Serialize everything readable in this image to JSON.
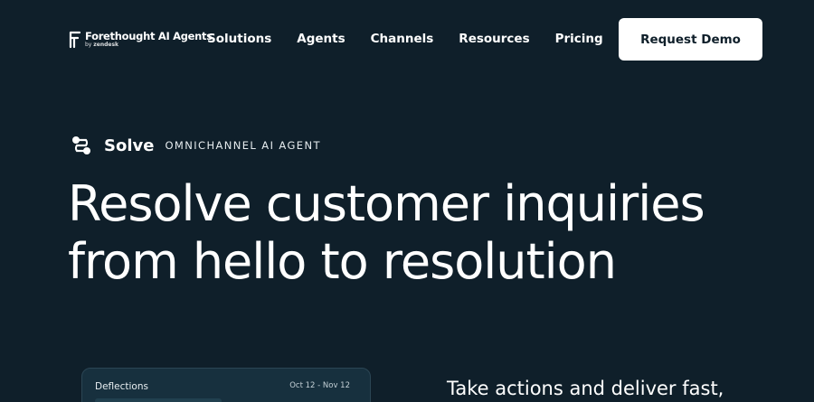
{
  "nav": {
    "logo_name": "Forethought AI Agents",
    "logo_sub_prefix": "by",
    "logo_sub_brand": "zendesk",
    "links": [
      "Solutions",
      "Agents",
      "Channels",
      "Resources",
      "Pricing"
    ],
    "cta": "Request Demo"
  },
  "hero": {
    "product_name": "Solve",
    "product_tag": "OMNICHANNEL AI AGENT",
    "headline": "Resolve customer inquiries\nfrom hello to resolution"
  },
  "card": {
    "title": "Deflections",
    "date_range": "Oct 12 - Nov 12"
  },
  "subhead": "Take actions and deliver fast,",
  "colors": {
    "background": "#0f1f2a",
    "cta_background": "#ffffff",
    "card_background": "#17303e"
  }
}
